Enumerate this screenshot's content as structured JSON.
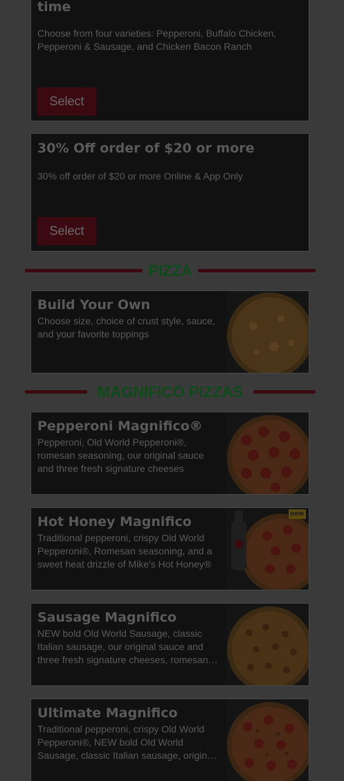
{
  "deals": [
    {
      "title": "time",
      "description": "Choose from four varieties: Pepperoni, Buffalo Chicken, Pepperoni & Sausage, and Chicken Bacon Ranch",
      "button_label": "Select"
    },
    {
      "title": "30% Off order of $20 or more",
      "description": "30% off order of $20 or more Online & App Only",
      "button_label": "Select"
    }
  ],
  "sections": {
    "pizza": {
      "heading": "PIZZA",
      "items": [
        {
          "title": "Build Your Own",
          "description": "Choose size, choice of crust style, sauce, and your favorite toppings",
          "image_icon": "cheese-pizza-icon"
        }
      ]
    },
    "magnifico": {
      "heading": "MAGNIFICO PIZZAS",
      "items": [
        {
          "title": "Pepperoni Magnifico®",
          "description": "Pepperoni, Old World Pepperoni®, romesan seasoning, our original sauce and three fresh signature cheeses",
          "image_icon": "pepperoni-pizza-icon"
        },
        {
          "title": "Hot Honey Magnifico",
          "description": "Traditional pepperoni, crispy Old World Pepperoni®, Romesan seasoning, and a sweet heat drizzle of Mike's Hot Honey®",
          "image_icon": "hot-honey-pizza-icon",
          "badge": "new"
        },
        {
          "title": "Sausage Magnifico",
          "description": "NEW bold Old World Sausage, classic Italian sausage, our original sauce and three fresh signature cheeses, romesan…",
          "image_icon": "sausage-pizza-icon"
        },
        {
          "title": "Ultimate Magnifico",
          "description": "Traditional pepperoni, crispy Old World Pepperoni®, NEW bold Old World Sausage, classic Italian sausage, origin…",
          "image_icon": "ultimate-pizza-icon"
        }
      ]
    }
  },
  "colors": {
    "page_background": "#3a3a3a",
    "card_background": "#111111",
    "accent_red": "#3b0a10",
    "heading_green": "#0e4a1a",
    "text_gray": "#5a5a5a"
  }
}
